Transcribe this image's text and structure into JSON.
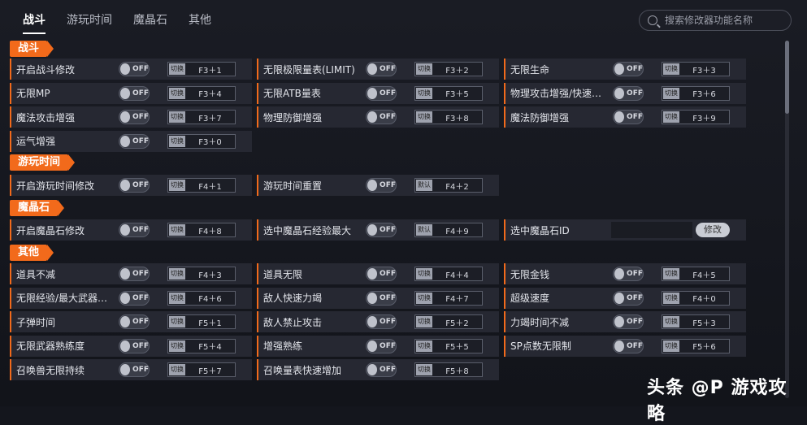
{
  "tabs": [
    "战斗",
    "游玩时间",
    "魔晶石",
    "其他"
  ],
  "search": {
    "placeholder": "搜索修改器功能名称"
  },
  "toggle_text": "OFF",
  "key_tag": "切换",
  "key_tag_alt": "默认",
  "edit_label": "修改",
  "colors": {
    "accent": "#f26a1b",
    "panel": "#262832",
    "background": "#14161d"
  },
  "sections": {
    "battle": {
      "title": "战斗",
      "rows": [
        [
          {
            "label": "开启战斗修改",
            "key": "F3＋1"
          },
          {
            "label": "无限极限量表(LIMIT)",
            "key": "F3＋2"
          },
          {
            "label": "无限生命",
            "key": "F3＋3"
          }
        ],
        [
          {
            "label": "无限MP",
            "key": "F3＋4"
          },
          {
            "label": "无限ATB量表",
            "key": "F3＋5"
          },
          {
            "label": "物理攻击增强/快速击杀",
            "key": "F3＋6"
          }
        ],
        [
          {
            "label": "魔法攻击增强",
            "key": "F3＋7"
          },
          {
            "label": "物理防御增强",
            "key": "F3＋8"
          },
          {
            "label": "魔法防御增强",
            "key": "F3＋9"
          }
        ],
        [
          {
            "label": "运气增强",
            "key": "F3＋0"
          }
        ]
      ]
    },
    "playtime": {
      "title": "游玩时间",
      "rows": [
        [
          {
            "label": "开启游玩时间修改",
            "key": "F4＋1"
          },
          {
            "label": "游玩时间重置",
            "key": "F4＋2"
          }
        ]
      ]
    },
    "crystal": {
      "title": "魔晶石",
      "rows": [
        [
          {
            "label": "开启魔晶石修改",
            "key": "F4＋8"
          },
          {
            "label": "选中魔晶石经验最大",
            "key": "F4＋9"
          },
          {
            "label": "选中魔晶石ID"
          }
        ]
      ]
    },
    "other": {
      "title": "其他",
      "rows": [
        [
          {
            "label": "道具不减",
            "key": "F4＋3"
          },
          {
            "label": "道具无限",
            "key": "F4＋4"
          },
          {
            "label": "无限金钱",
            "key": "F4＋5"
          }
        ],
        [
          {
            "label": "无限经验/最大武器等级",
            "key": "F4＋6"
          },
          {
            "label": "敌人快速力竭",
            "key": "F4＋7"
          },
          {
            "label": "超级速度",
            "key": "F4＋0"
          }
        ],
        [
          {
            "label": "子弹时间",
            "key": "F5＋1"
          },
          {
            "label": "敌人禁止攻击",
            "key": "F5＋2"
          },
          {
            "label": "力竭时间不减",
            "key": "F5＋3"
          }
        ],
        [
          {
            "label": "无限武器熟练度",
            "key": "F5＋4"
          },
          {
            "label": "增强熟练",
            "key": "F5＋5"
          },
          {
            "label": "SP点数无限制",
            "key": "F5＋6"
          }
        ],
        [
          {
            "label": "召唤兽无限持续",
            "key": "F5＋7"
          },
          {
            "label": "召唤量表快速增加",
            "key": "F5＋8"
          }
        ]
      ]
    }
  },
  "watermark": {
    "text": "头条 @P 游戏攻略"
  }
}
